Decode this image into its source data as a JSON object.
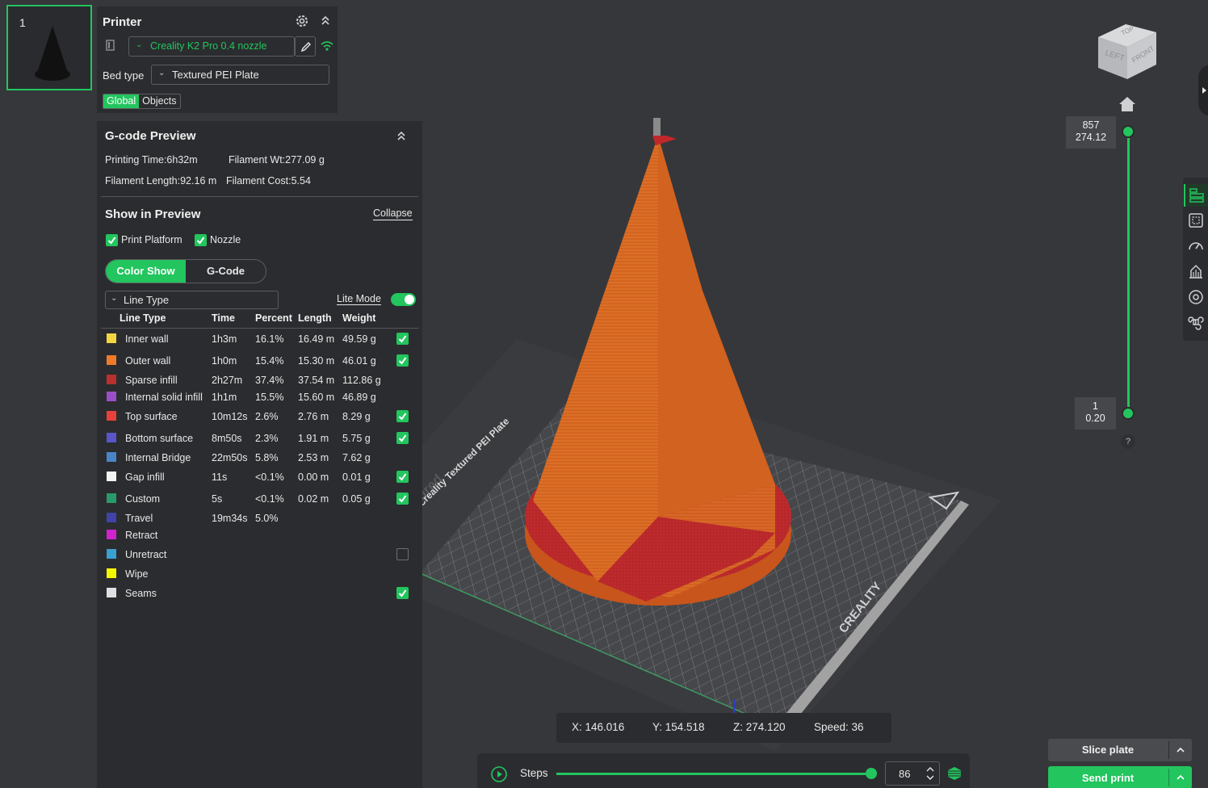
{
  "plate": {
    "number": "1"
  },
  "printer": {
    "title": "Printer",
    "profile": "Creality K2 Pro 0.4 nozzle",
    "bed_label": "Bed type",
    "bed_value": "Textured PEI Plate",
    "scope_tabs": [
      "Global",
      "Objects"
    ]
  },
  "gcode": {
    "title": "G-code Preview",
    "printing_time": "Printing Time:6h32m",
    "filament_wt": "Filament Wt:277.09 g",
    "filament_length": "Filament Length:92.16 m",
    "filament_cost": "Filament Cost:5.54",
    "show_title": "Show in Preview",
    "collapse": "Collapse",
    "print_platform": "Print Platform",
    "nozzle": "Nozzle",
    "mode_tabs": [
      "Color Show",
      "G-Code"
    ],
    "view_select": "Line Type",
    "lite_mode": "Lite Mode",
    "headers": [
      "Line Type",
      "Time",
      "Percent",
      "Length",
      "Weight"
    ],
    "rows": [
      {
        "name": "Inner wall",
        "color": "#f5d442",
        "time": "1h3m",
        "percent": "16.1%",
        "length": "16.49 m",
        "weight": "49.59 g",
        "checkbox": "on"
      },
      {
        "name": "Outer wall",
        "color": "#f07a2a",
        "time": "1h0m",
        "percent": "15.4%",
        "length": "15.30 m",
        "weight": "46.01 g",
        "checkbox": "on"
      },
      {
        "name": "Sparse infill",
        "color": "#b8312f",
        "time": "2h27m",
        "percent": "37.4%",
        "length": "37.54 m",
        "weight": "112.86 g",
        "checkbox": "none"
      },
      {
        "name": "Internal solid infill",
        "color": "#9a4fc9",
        "time": "1h1m",
        "percent": "15.5%",
        "length": "15.60 m",
        "weight": "46.89 g",
        "checkbox": "none"
      },
      {
        "name": "Top surface",
        "color": "#e8403a",
        "time": "10m12s",
        "percent": "2.6%",
        "length": "2.76 m",
        "weight": "8.29 g",
        "checkbox": "on"
      },
      {
        "name": "Bottom surface",
        "color": "#5a55c8",
        "time": "8m50s",
        "percent": "2.3%",
        "length": "1.91 m",
        "weight": "5.75 g",
        "checkbox": "on"
      },
      {
        "name": "Internal Bridge",
        "color": "#4a85c8",
        "time": "22m50s",
        "percent": "5.8%",
        "length": "2.53 m",
        "weight": "7.62 g",
        "checkbox": "none"
      },
      {
        "name": "Gap infill",
        "color": "#f4f4f4",
        "time": "11s",
        "percent": "<0.1%",
        "length": "0.00 m",
        "weight": "0.01 g",
        "checkbox": "on"
      },
      {
        "name": "Custom",
        "color": "#2a9a6a",
        "time": "5s",
        "percent": "<0.1%",
        "length": "0.02 m",
        "weight": "0.05 g",
        "checkbox": "on"
      },
      {
        "name": "Travel",
        "color": "#4044a8",
        "time": "19m34s",
        "percent": "5.0%",
        "length": "",
        "weight": "",
        "checkbox": "none"
      },
      {
        "name": "Retract",
        "color": "#d023d0",
        "time": "",
        "percent": "",
        "length": "",
        "weight": "",
        "checkbox": "none"
      },
      {
        "name": "Unretract",
        "color": "#3aa0d0",
        "time": "",
        "percent": "",
        "length": "",
        "weight": "",
        "checkbox": "off"
      },
      {
        "name": "Wipe",
        "color": "#f5f500",
        "time": "",
        "percent": "",
        "length": "",
        "weight": "",
        "checkbox": "none"
      },
      {
        "name": "Seams",
        "color": "#e0e0e0",
        "time": "",
        "percent": "",
        "length": "",
        "weight": "",
        "checkbox": "on"
      }
    ]
  },
  "viewport": {
    "plate_label": "Creality Textured PEI Plate",
    "brand": "CREALITY",
    "nav_cube": {
      "top": "TOP",
      "left": "LEFT",
      "front": "FRONT"
    },
    "layer_top": {
      "layer": "857",
      "height": "274.12"
    },
    "layer_bottom": {
      "layer": "1",
      "height": "0.20"
    },
    "help": "?"
  },
  "coords": {
    "x": "X: 146.016",
    "y": "Y: 154.518",
    "z": "Z: 274.120",
    "speed": "Speed: 36"
  },
  "steps": {
    "label": "Steps",
    "value": "86",
    "fraction": 1.0
  },
  "actions": {
    "slice": "Slice plate",
    "send": "Send print"
  },
  "colors": {
    "accent": "#22c55e",
    "model_orange": "#d9651f",
    "model_red": "#c0282a"
  }
}
